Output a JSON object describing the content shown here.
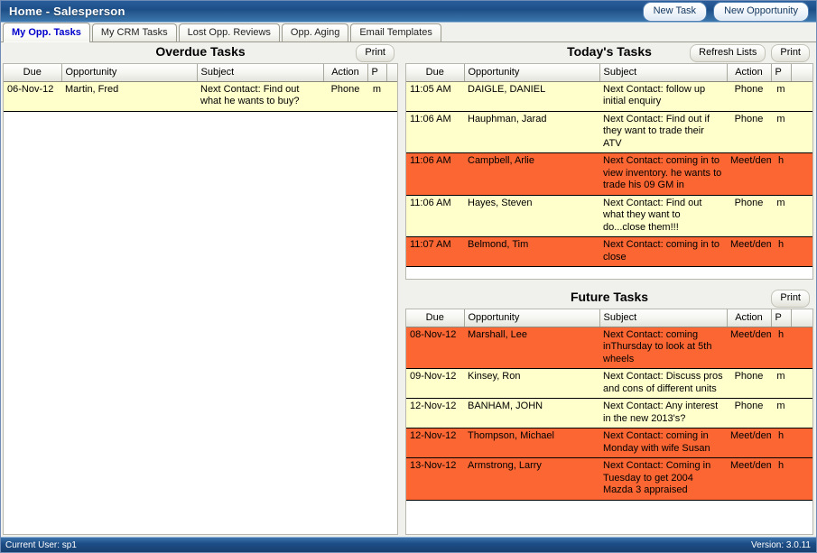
{
  "window": {
    "title": "Home - Salesperson"
  },
  "header": {
    "buttons": [
      {
        "label": "New Task",
        "name": "new-task-button"
      },
      {
        "label": "New Opportunity",
        "name": "new-opportunity-button"
      }
    ]
  },
  "tabs": [
    {
      "label": "My Opp. Tasks",
      "active": true
    },
    {
      "label": "My CRM Tasks",
      "active": false
    },
    {
      "label": "Lost Opp. Reviews",
      "active": false
    },
    {
      "label": "Opp. Aging",
      "active": false
    },
    {
      "label": "Email Templates",
      "active": false
    }
  ],
  "columns": [
    "Due",
    "Opportunity",
    "Subject",
    "Action",
    "P",
    ""
  ],
  "panels": {
    "overdue": {
      "title": "Overdue Tasks",
      "buttons": [
        {
          "label": "Print",
          "name": "print-overdue-button"
        }
      ],
      "rows": [
        {
          "due": "06-Nov-12",
          "opportunity": "Martin, Fred",
          "subject": "Next Contact: Find out what he wants to buy?",
          "action": "Phone",
          "priority": "m",
          "color": "yellow"
        }
      ]
    },
    "today": {
      "title": "Today's Tasks",
      "buttons": [
        {
          "label": "Refresh Lists",
          "name": "refresh-lists-button"
        },
        {
          "label": "Print",
          "name": "print-today-button"
        }
      ],
      "rows": [
        {
          "due": "11:05 AM",
          "opportunity": "DAIGLE, DANIEL",
          "subject": "Next Contact: follow up initial enquiry",
          "action": "Phone",
          "priority": "m",
          "color": "yellow"
        },
        {
          "due": "11:06 AM",
          "opportunity": "Hauphman, Jarad",
          "subject": "Next Contact: Find out if they want to trade their ATV",
          "action": "Phone",
          "priority": "m",
          "color": "yellow"
        },
        {
          "due": "11:06 AM",
          "opportunity": "Campbell, Arlie",
          "subject": "Next Contact: coming in to view inventory. he wants to trade his 09 GM in",
          "action": "Meet/demo",
          "priority": "h",
          "color": "orange"
        },
        {
          "due": "11:06 AM",
          "opportunity": "Hayes, Steven",
          "subject": "Next Contact: Find out what they want to do...close them!!!",
          "action": "Phone",
          "priority": "m",
          "color": "yellow"
        },
        {
          "due": "11:07 AM",
          "opportunity": "Belmond, Tim",
          "subject": "Next Contact: coming in to close",
          "action": "Meet/demo",
          "priority": "h",
          "color": "orange"
        }
      ]
    },
    "future": {
      "title": "Future Tasks",
      "buttons": [
        {
          "label": "Print",
          "name": "print-future-button"
        }
      ],
      "rows": [
        {
          "due": "08-Nov-12",
          "opportunity": "Marshall, Lee",
          "subject": "Next Contact: coming inThursday to look at 5th wheels",
          "action": "Meet/demo",
          "priority": "h",
          "color": "orange"
        },
        {
          "due": "09-Nov-12",
          "opportunity": "Kinsey, Ron",
          "subject": "Next Contact: Discuss pros and cons of different units",
          "action": "Phone",
          "priority": "m",
          "color": "yellow"
        },
        {
          "due": "12-Nov-12",
          "opportunity": "BANHAM, JOHN",
          "subject": "Next Contact: Any interest in the new 2013's?",
          "action": "Phone",
          "priority": "m",
          "color": "yellow"
        },
        {
          "due": "12-Nov-12",
          "opportunity": "Thompson, Michael",
          "subject": "Next Contact: coming in Monday with wife Susan",
          "action": "Meet/demo",
          "priority": "h",
          "color": "orange"
        },
        {
          "due": "13-Nov-12",
          "opportunity": "Armstrong, Larry",
          "subject": "Next Contact: Coming in Tuesday to get 2004 Mazda 3 appraised",
          "action": "Meet/demo",
          "priority": "h",
          "color": "orange"
        }
      ]
    }
  },
  "statusbar": {
    "left": "Current User: sp1",
    "right": "Version: 3.0.11"
  },
  "colors": {
    "row_yellow": "#ffffcc",
    "row_orange": "#fb6633",
    "titlebar_blue": "#1d4e87",
    "active_tab_text": "#0000cc"
  }
}
